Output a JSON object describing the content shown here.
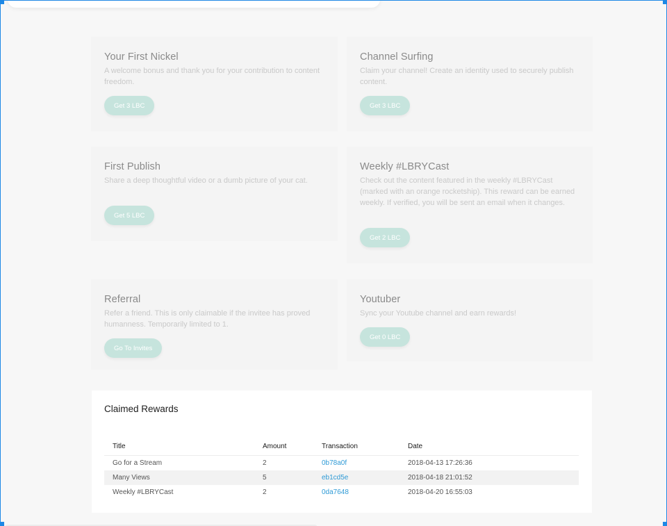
{
  "rewards": [
    {
      "title": "Your First Nickel",
      "description": "A welcome bonus and thank you for your contribution to content freedom.",
      "button_label": "Get 3 LBC"
    },
    {
      "title": "Channel Surfing",
      "description": "Claim your channel! Create an identity used to securely publish content.",
      "button_label": "Get 3 LBC"
    },
    {
      "title": "First Publish",
      "description": "Share a deep thoughtful video or a dumb picture of your cat.",
      "button_label": "Get 5 LBC"
    },
    {
      "title": "Weekly #LBRYCast",
      "description": "Check out the content featured in the weekly #LBRYCast (marked with an orange rocketship). This reward can be earned weekly. If verified, you will be sent an email when it changes.",
      "button_label": "Get 2 LBC"
    },
    {
      "title": "Referral",
      "description": "Refer a friend. This is only claimable if the invitee has proved humanness. Temporarily limited to 1.",
      "button_label": "Go To Invites"
    },
    {
      "title": "Youtuber",
      "description": "Sync your Youtube channel and earn rewards!",
      "button_label": "Get 0 LBC"
    }
  ],
  "claimed": {
    "title": "Claimed Rewards",
    "columns": [
      "Title",
      "Amount",
      "Transaction",
      "Date"
    ],
    "rows": [
      {
        "title": "Go for a Stream",
        "amount": "2",
        "transaction": "0b78a0f",
        "date": "2018-04-13 17:26:36"
      },
      {
        "title": "Many Views",
        "amount": "5",
        "transaction": "eb1cd5e",
        "date": "2018-04-18 21:01:52"
      },
      {
        "title": "Weekly #LBRYCast",
        "amount": "2",
        "transaction": "0da7648",
        "date": "2018-04-20 16:55:03"
      }
    ]
  },
  "colors": {
    "accent": "#c6e4dd",
    "link": "#2e9ad6",
    "selection_border": "#1e88e5"
  }
}
